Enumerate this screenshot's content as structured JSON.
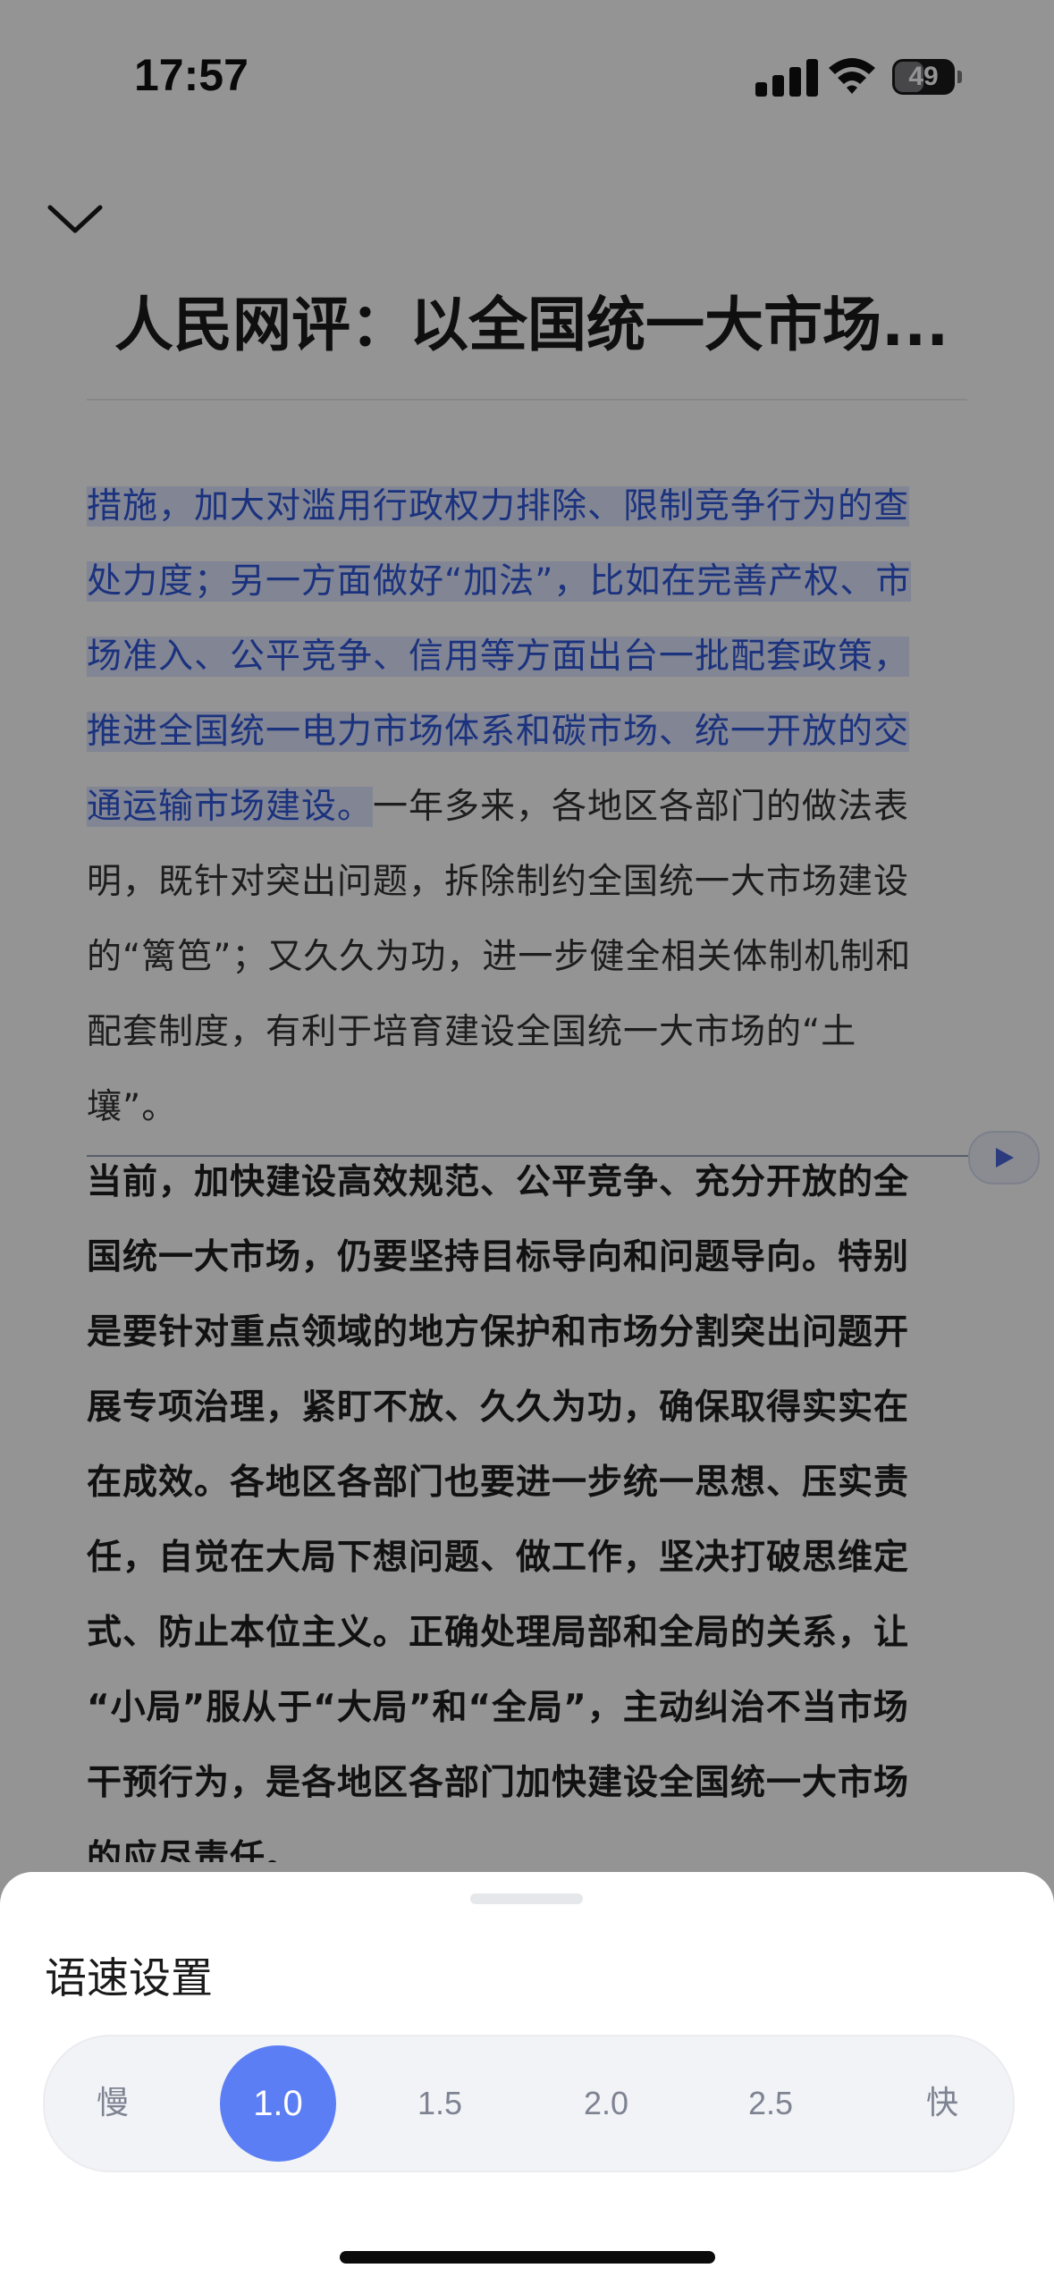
{
  "status_bar": {
    "time": "17:57",
    "battery": "49"
  },
  "article": {
    "title": "人民网评：以全国统一大市场...",
    "highlighted_lines": [
      "措施，加大对滥用行政权力排除、限制竞争行为的查",
      "处力度；另一方面做好“加法”，比如在完善产权、市",
      "场准入、公平竞争、信用等方面出台一批配套政策，",
      "推进全国统一电力市场体系和碳市场、统一开放的交"
    ],
    "highlight_end": "通运输市场建设。",
    "line5_rest": "一年多来，各地区各部门的做法表",
    "para1_lines": [
      "明，既针对突出问题，拆除制约全国统一大市场建设",
      "的“篱笆”；又久久为功，进一步健全相关体制机制和",
      "配套制度，有利于培育建设全国统一大市场的“土",
      "壤”。"
    ],
    "para2_lines": [
      "当前，加快建设高效规范、公平竞争、充分开放的全",
      "国统一大市场，仍要坚持目标导向和问题导向。特别",
      "是要针对重点领域的地方保护和市场分割突出问题开",
      "展专项治理，紧盯不放、久久为功，确保取得实实在",
      "在成效。各地区各部门也要进一步统一思想、压实责",
      "任，自觉在大局下想问题、做工作，坚决打破思维定",
      "式、防止本位主义。正确处理局部和全局的关系，让",
      "“小局”服从于“大局”和“全局”，主动纠治不当市场",
      "干预行为，是各地区各部门加快建设全国统一大市场",
      "的应尽责任。"
    ]
  },
  "speed_sheet": {
    "title": "语速设置",
    "options": {
      "slow": "慢",
      "s1": "1.0",
      "s2": "1.5",
      "s3": "2.0",
      "s4": "2.5",
      "fast": "快"
    },
    "selected": "1.0"
  },
  "colors": {
    "accent": "#5b7ef5",
    "highlight_text": "#2f56d9",
    "highlight_bg": "#dfe6ff"
  }
}
